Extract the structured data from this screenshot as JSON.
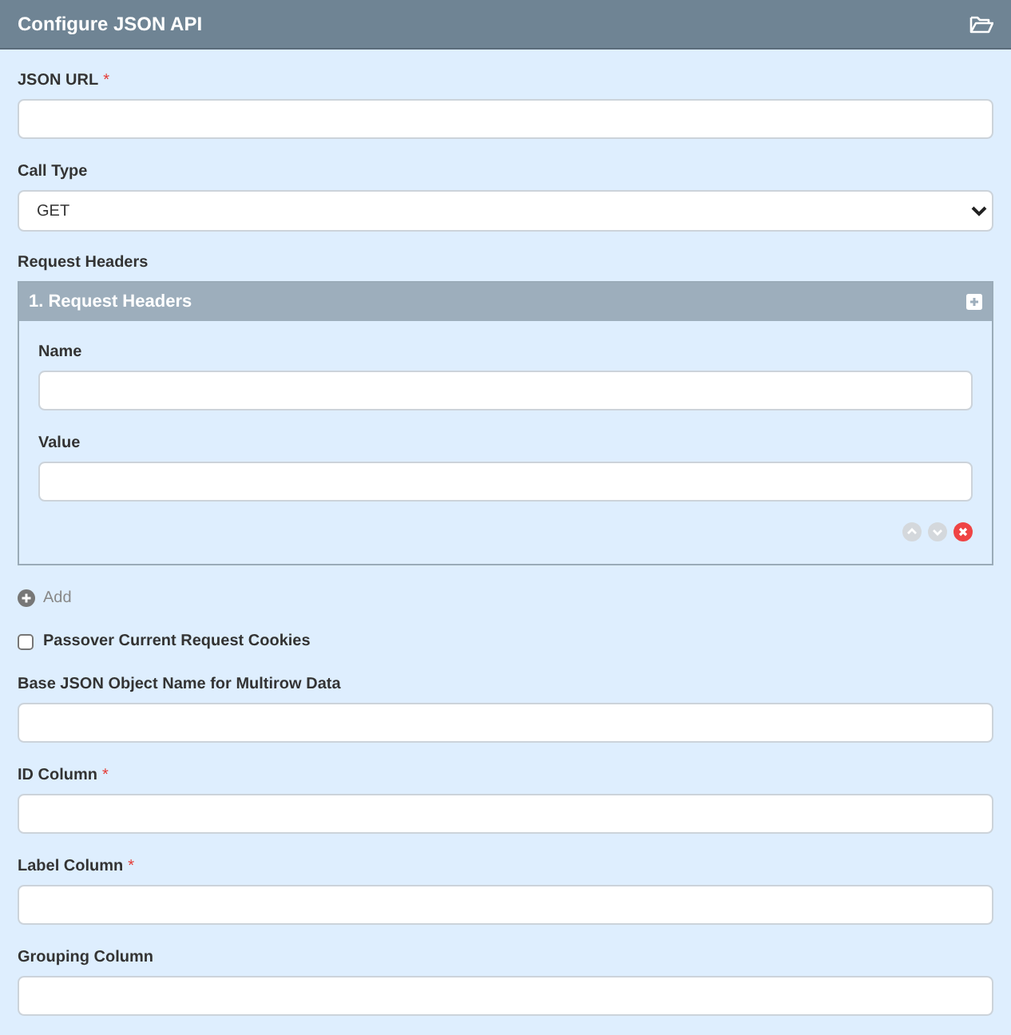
{
  "panel": {
    "title": "Configure JSON API"
  },
  "fields": [
    {
      "kind": "text",
      "label": "JSON URL",
      "required_mark": "*"
    },
    {
      "kind": "select",
      "label": "Call Type",
      "value": "GET"
    },
    {
      "kind": "group",
      "label": "Request Headers",
      "items": [
        {
          "title": "1. Request Headers",
          "fields": [
            {
              "label": "Name"
            },
            {
              "label": "Value"
            }
          ],
          "move_up_disabled": true,
          "move_down_disabled": true
        }
      ],
      "add_label": "Add"
    },
    {
      "kind": "checkbox",
      "label": "Passover Current Request Cookies",
      "checked": false
    },
    {
      "kind": "text",
      "label": "Base JSON Object Name for Multirow Data"
    },
    {
      "kind": "text",
      "label": "ID Column",
      "required_mark": "*"
    },
    {
      "kind": "text",
      "label": "Label Column",
      "required_mark": "*"
    },
    {
      "kind": "text",
      "label": "Grouping Column"
    }
  ]
}
